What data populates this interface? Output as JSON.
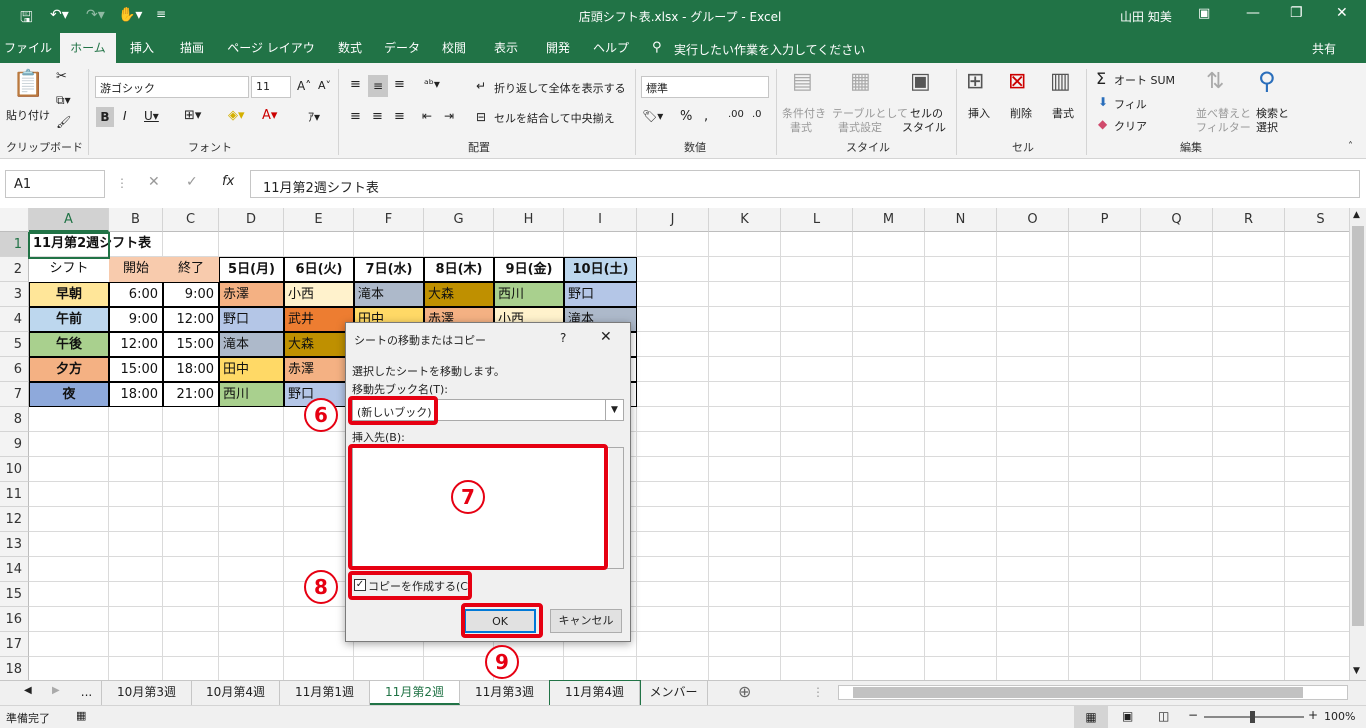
{
  "window": {
    "title": "店頭シフト表.xlsx - グループ - Excel",
    "user": "山田 知美"
  },
  "ribbon_tabs": [
    "ファイル",
    "ホーム",
    "挿入",
    "描画",
    "ページ レイアウト",
    "数式",
    "データ",
    "校閲",
    "表示",
    "開発",
    "ヘルプ"
  ],
  "tell_me": "実行したい作業を入力してください",
  "share": "共有",
  "ribbon": {
    "paste": "貼り付け",
    "clipboard": "クリップボード",
    "font_name": "游ゴシック",
    "font_size": "11",
    "font_group": "フォント",
    "wrap": "折り返して全体を表示する",
    "merge": "セルを結合して中央揃え",
    "align_group": "配置",
    "number_format": "標準",
    "number_group": "数値",
    "cond1": "条件付き",
    "cond2": "書式",
    "table1": "テーブルとして",
    "table2": "書式設定",
    "cellstyle1": "セルの",
    "cellstyle2": "スタイル",
    "styles_group": "スタイル",
    "insert": "挿入",
    "delete": "削除",
    "format": "書式",
    "cells_group": "セル",
    "autosum": "オート SUM",
    "fill": "フィル",
    "clear": "クリア",
    "sort1": "並べ替えと",
    "sort2": "フィルター",
    "find1": "検索と",
    "find2": "選択",
    "edit_group": "編集"
  },
  "formula_bar": {
    "name_box": "A1",
    "content": "11月第2週シフト表"
  },
  "columns": [
    "A",
    "B",
    "C",
    "D",
    "E",
    "F",
    "G",
    "H",
    "I",
    "J",
    "K",
    "L",
    "M",
    "N",
    "O",
    "P",
    "Q",
    "R",
    "S"
  ],
  "rows": [
    "1",
    "2",
    "3",
    "4",
    "5",
    "6",
    "7",
    "8",
    "9",
    "10",
    "11",
    "12",
    "13",
    "14",
    "15",
    "16",
    "17",
    "18"
  ],
  "grid": {
    "title": "11月第2週シフト表",
    "headers": [
      "シフト",
      "開始",
      "終了",
      "5日(月)",
      "6日(火)",
      "7日(水)",
      "8日(木)",
      "9日(金)",
      "10日(土)"
    ],
    "rows": [
      [
        "早朝",
        "6:00",
        "9:00",
        "赤澤",
        "小西",
        "滝本",
        "大森",
        "西川",
        "野口"
      ],
      [
        "午前",
        "9:00",
        "12:00",
        "野口",
        "武井",
        "田中",
        "赤澤",
        "小西",
        "滝本"
      ],
      [
        "午後",
        "12:00",
        "15:00",
        "滝本",
        "大森",
        "",
        "",
        "",
        ""
      ],
      [
        "夕方",
        "15:00",
        "18:00",
        "田中",
        "赤澤",
        "",
        "",
        "",
        ""
      ],
      [
        "夜",
        "18:00",
        "21:00",
        "西川",
        "野口",
        "",
        "",
        "",
        ""
      ]
    ]
  },
  "colors": {
    "excel_green": "#217346",
    "early": "#ffe699",
    "morning": "#bdd7ee",
    "afternoon": "#a9d08e",
    "evening": "#f4b183",
    "night": "#8ea9db",
    "red": "#e60012"
  },
  "dialog": {
    "title": "シートの移動またはコピー",
    "help": "?",
    "close": "✕",
    "instruction": "選択したシートを移動します。",
    "book_label": "移動先ブック名(T):",
    "book_value": "(新しいブック)",
    "before_label": "挿入先(B):",
    "copy_label": "コピーを作成する(C)",
    "copy_checked": true,
    "ok": "OK",
    "cancel": "キャンセル"
  },
  "annotations": [
    "6",
    "7",
    "8",
    "9"
  ],
  "sheet_tabs": [
    "...",
    "10月第3週",
    "10月第4週",
    "11月第1週",
    "11月第2週",
    "11月第3週",
    "11月第4週",
    "メンバー"
  ],
  "status": {
    "ready": "準備完了",
    "zoom": "100%"
  }
}
